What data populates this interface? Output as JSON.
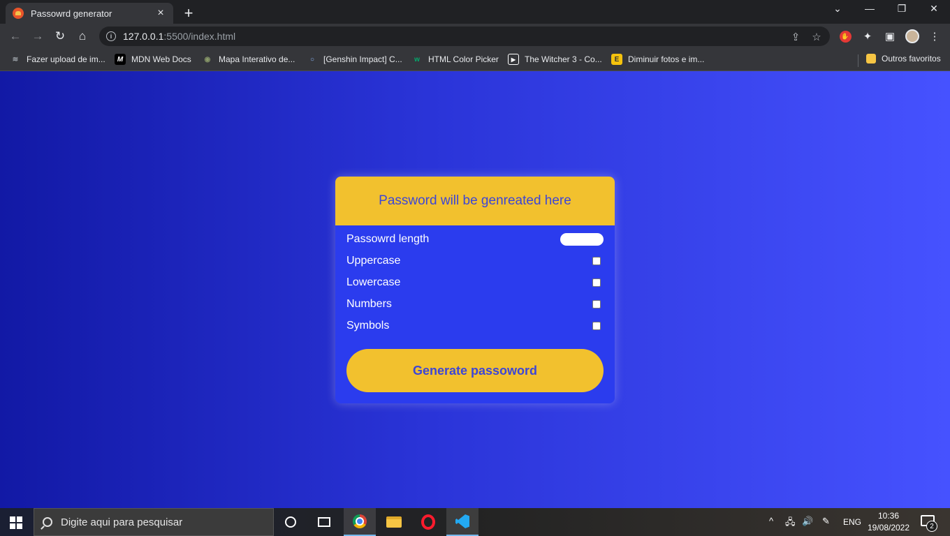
{
  "browser": {
    "tab": {
      "title": "Passowrd generator",
      "close_icon": "×"
    },
    "new_tab_icon": "+",
    "window_controls": {
      "tab_search": "⌄",
      "minimize": "—",
      "restore": "❐",
      "close": "✕"
    },
    "nav": {
      "back": "←",
      "forward": "→",
      "reload": "↻",
      "home": "⌂"
    },
    "address_bar": {
      "host": "127.0.0.1",
      "rest": ":5500/index.html",
      "info_icon": "i"
    },
    "address_actions": {
      "share": "⇪",
      "bookmark": "☆"
    },
    "extensions": {
      "adblock": "✋",
      "puzzle": "✦",
      "sidepanel": "▣",
      "menu": "⋮"
    },
    "bookmarks": [
      {
        "label": "Fazer upload de im...",
        "icon": "layers-icon",
        "color": "#9aa0a6",
        "glyph": "≋"
      },
      {
        "label": "MDN Web Docs",
        "icon": "mdn-icon",
        "color": "#ffffff",
        "glyph": "M"
      },
      {
        "label": "Mapa Interativo de...",
        "icon": "map-icon",
        "color": "#8a9a6a",
        "glyph": "◉"
      },
      {
        "label": "[Genshin Impact] C...",
        "icon": "loading-icon",
        "color": "#8ab4f8",
        "glyph": "○"
      },
      {
        "label": "HTML Color Picker",
        "icon": "w3-icon",
        "color": "#04aa6d",
        "glyph": "w"
      },
      {
        "label": "The Witcher 3 - Co...",
        "icon": "play-icon",
        "color": "#ffffff",
        "glyph": "▶"
      },
      {
        "label": "Diminuir fotos e im...",
        "icon": "easy-icon",
        "color": "#f4c20d",
        "glyph": "E"
      }
    ],
    "other_bookmarks": "Outros favoritos"
  },
  "app": {
    "result_placeholder": "Password will be genreated here",
    "options": [
      {
        "label": "Passowrd length",
        "type": "number"
      },
      {
        "label": "Uppercase",
        "type": "checkbox",
        "checked": false
      },
      {
        "label": "Lowercase",
        "type": "checkbox",
        "checked": false
      },
      {
        "label": "Numbers",
        "type": "checkbox",
        "checked": false
      },
      {
        "label": "Symbols",
        "type": "checkbox",
        "checked": false
      }
    ],
    "generate_label": "Generate passoword",
    "colors": {
      "accent": "#f2c12e",
      "card": "#2b3cee",
      "text_accent": "#3d46d6"
    }
  },
  "taskbar": {
    "search_placeholder": "Digite aqui para pesquisar",
    "tray": {
      "chevron": "^",
      "network": "🖧",
      "volume": "🔊",
      "pen": "✎",
      "language": "ENG"
    },
    "clock": {
      "time": "10:36",
      "date": "19/08/2022"
    },
    "notification_count": "2"
  }
}
